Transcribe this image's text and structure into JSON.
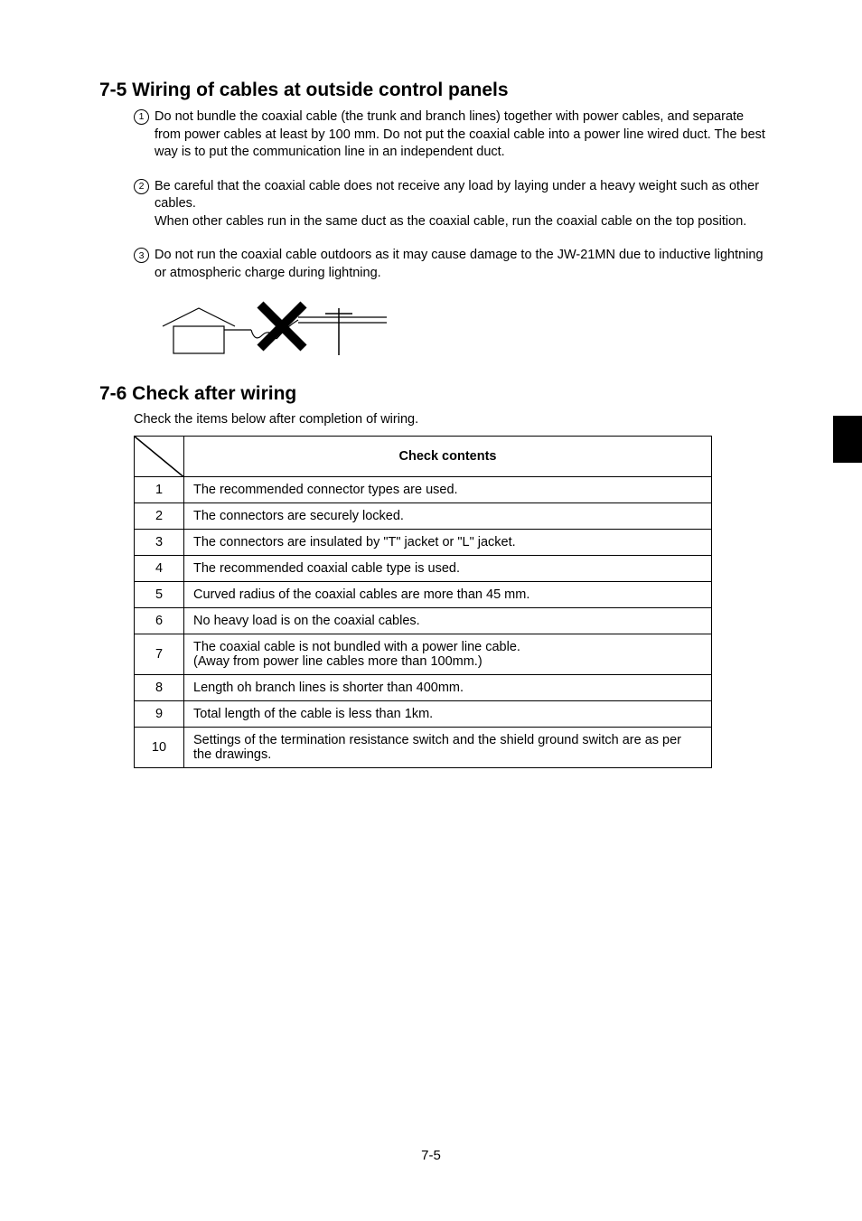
{
  "section75": {
    "title": "7-5 Wiring of cables at outside control panels",
    "items": [
      "Do not bundle the coaxial cable (the trunk and branch lines) together with power cables, and separate from power cables at least by 100 mm. Do not put the coaxial cable into a power line wired duct. The best way is to put the communication line in an independent duct.",
      "Be careful that the coaxial cable does not receive any load by laying under a heavy weight such as other cables.\nWhen other cables run in the same duct as the coaxial cable, run the coaxial cable on the top position.",
      "Do not run the coaxial cable outdoors as it may cause damage to the JW-21MN due to inductive lightning or atmospheric charge during lightning."
    ]
  },
  "section76": {
    "title": "7-6 Check after wiring",
    "intro": "Check the items below after completion of wiring.",
    "header": "Check contents",
    "rows": [
      {
        "n": "1",
        "text": "The recommended connector types are used."
      },
      {
        "n": "2",
        "text": "The connectors are securely locked."
      },
      {
        "n": "3",
        "text": "The connectors are insulated by \"T\" jacket or \"L\" jacket."
      },
      {
        "n": "4",
        "text": "The recommended coaxial cable type is used."
      },
      {
        "n": "5",
        "text": "Curved radius of the coaxial cables are more than 45 mm."
      },
      {
        "n": "6",
        "text": "No heavy load is on the coaxial cables."
      },
      {
        "n": "7",
        "text": "The coaxial cable is not bundled with a power line cable.\n(Away from power line cables more than 100mm.)"
      },
      {
        "n": "8",
        "text": "Length oh branch lines is shorter than 400mm."
      },
      {
        "n": "9",
        "text": "Total length of the cable is less than 1km."
      },
      {
        "n": "10",
        "text": "Settings of the termination resistance switch and the shield ground switch are as per the drawings."
      }
    ]
  },
  "pageNumber": "7-5"
}
